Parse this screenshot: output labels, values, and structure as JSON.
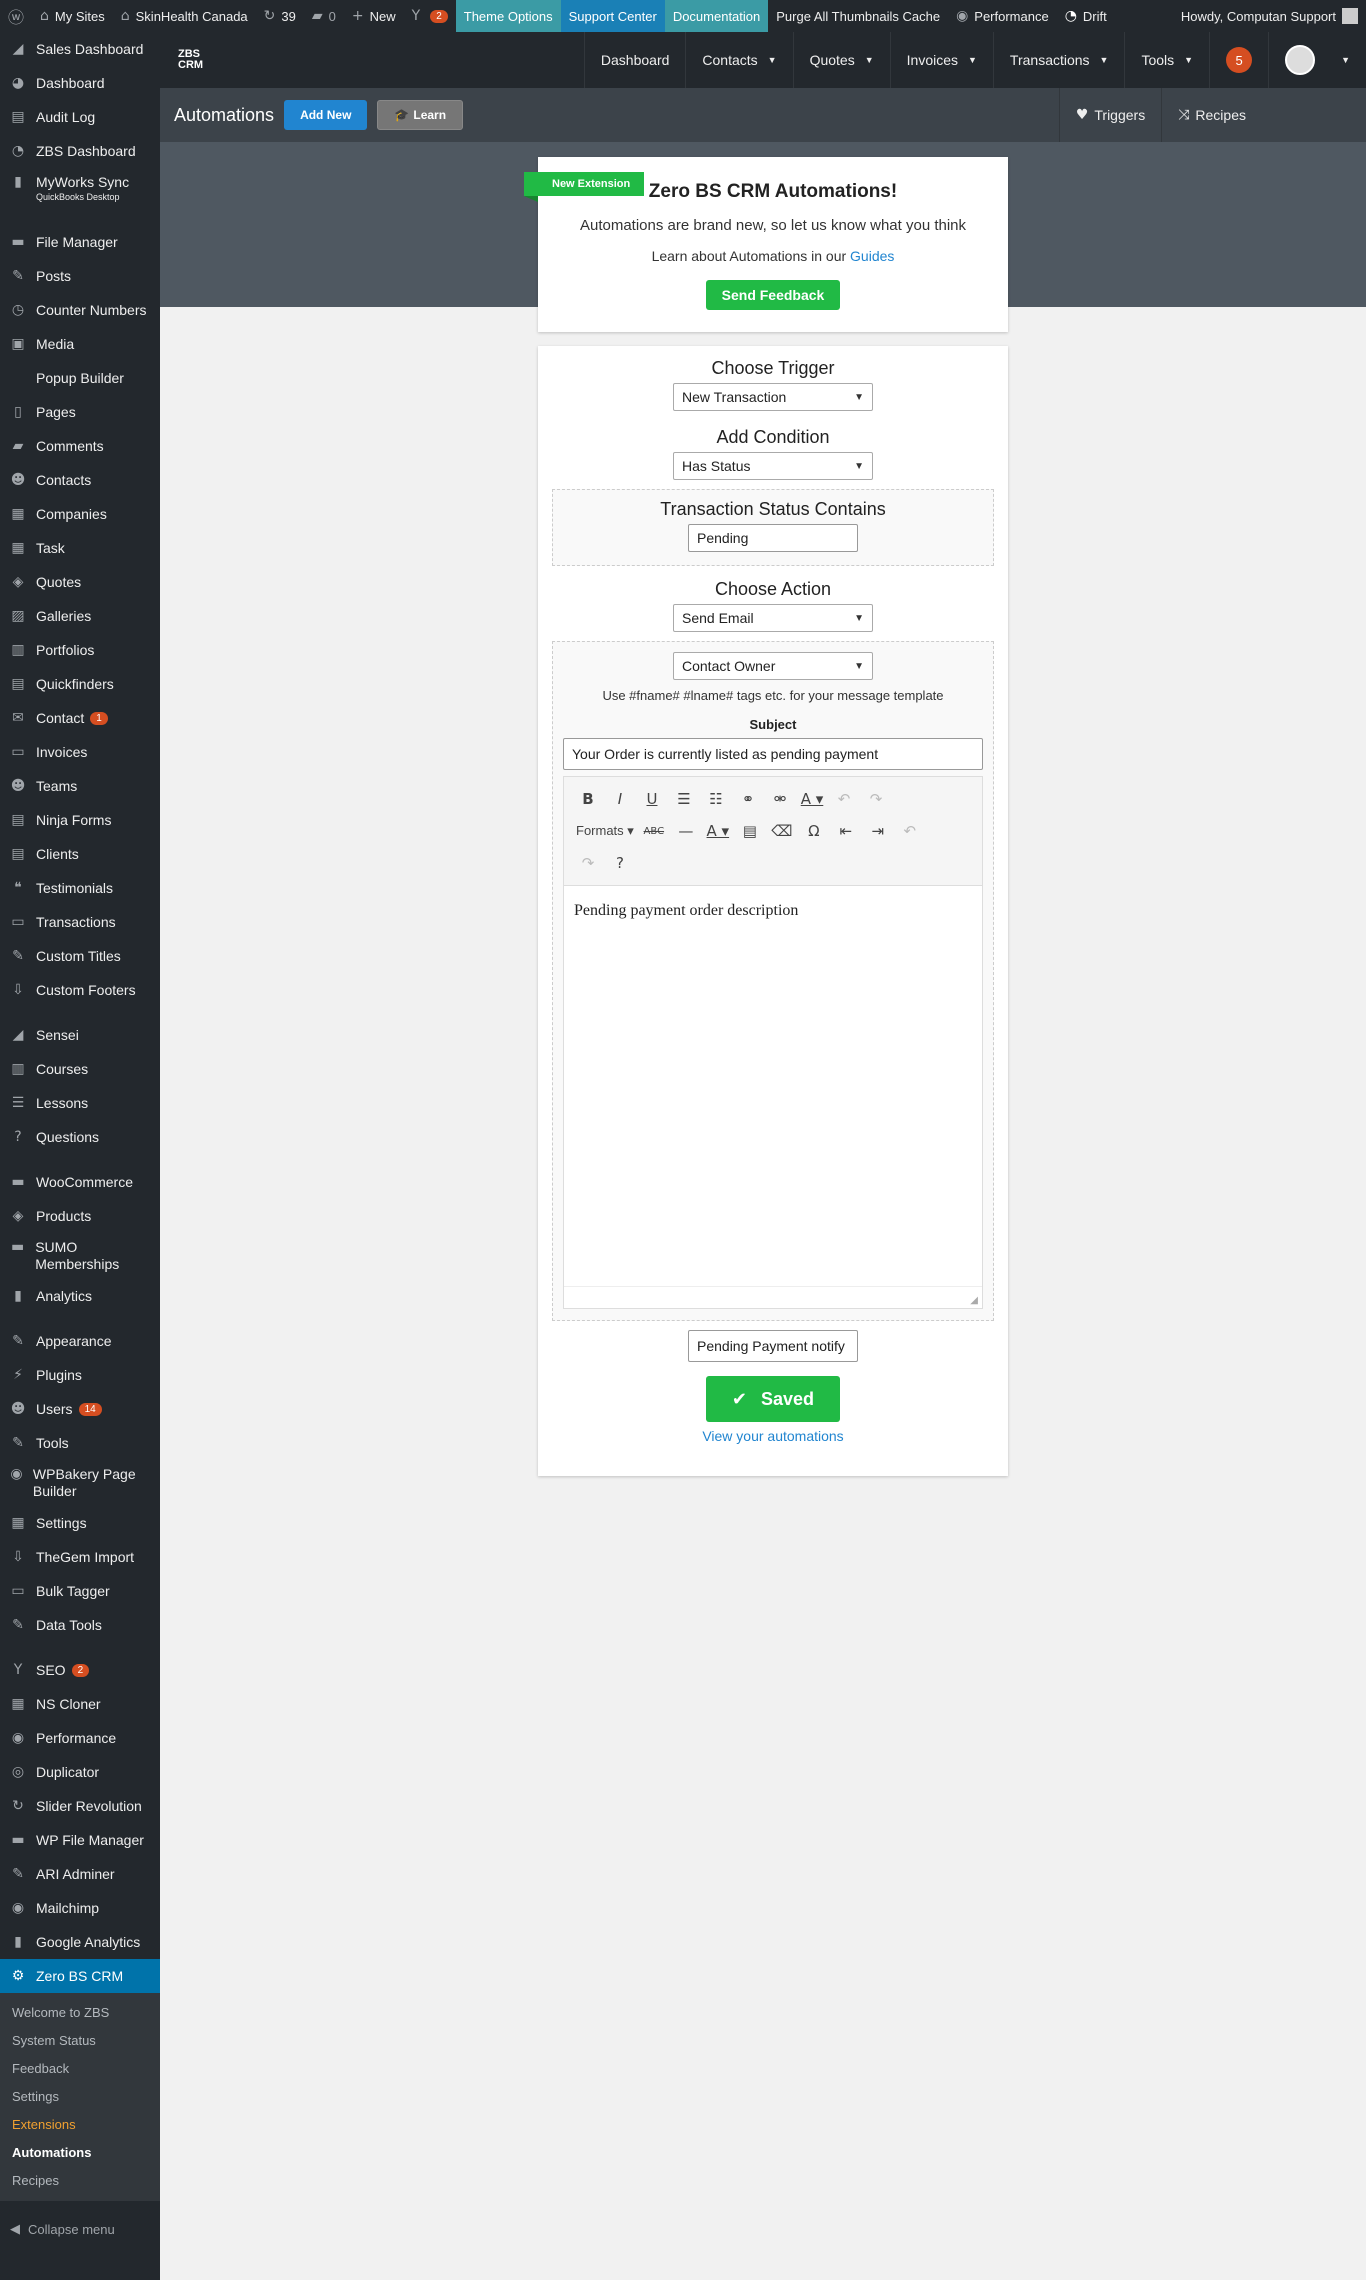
{
  "adminbar": {
    "my_sites": "My Sites",
    "site_name": "SkinHealth Canada",
    "updates_count": "39",
    "comments_count": "0",
    "new_label": "New",
    "yoast_count": "2",
    "theme_options": "Theme Options",
    "support_center": "Support Center",
    "documentation": "Documentation",
    "purge": "Purge All Thumbnails Cache",
    "performance": "Performance",
    "drift": "Drift",
    "howdy": "Howdy, Computan Support"
  },
  "sidebar": {
    "items": [
      {
        "label": "Sales Dashboard",
        "icon": "◢"
      },
      {
        "label": "Dashboard",
        "icon": "◕"
      },
      {
        "label": "Audit Log",
        "icon": "▤"
      },
      {
        "label": "ZBS Dashboard",
        "icon": "◔"
      },
      {
        "label": "MyWorks Sync",
        "sub": "QuickBooks Desktop",
        "icon": "▮"
      },
      {
        "label": "File Manager",
        "icon": "▬"
      },
      {
        "label": "Posts",
        "icon": "✎"
      },
      {
        "label": "Counter Numbers",
        "icon": "◷"
      },
      {
        "label": "Media",
        "icon": "▣"
      },
      {
        "label": "Popup Builder",
        "icon": ""
      },
      {
        "label": "Pages",
        "icon": "▯"
      },
      {
        "label": "Comments",
        "icon": "▰"
      },
      {
        "label": "Contacts",
        "icon": "☻"
      },
      {
        "label": "Companies",
        "icon": "▦"
      },
      {
        "label": "Task",
        "icon": "▦"
      },
      {
        "label": "Quotes",
        "icon": "◈"
      },
      {
        "label": "Galleries",
        "icon": "▨"
      },
      {
        "label": "Portfolios",
        "icon": "▥"
      },
      {
        "label": "Quickfinders",
        "icon": "▤"
      },
      {
        "label": "Contact",
        "badge": "1",
        "icon": "✉"
      },
      {
        "label": "Invoices",
        "icon": "▭"
      },
      {
        "label": "Teams",
        "icon": "☻"
      },
      {
        "label": "Ninja Forms",
        "icon": "▤"
      },
      {
        "label": "Clients",
        "icon": "▤"
      },
      {
        "label": "Testimonials",
        "icon": "❝"
      },
      {
        "label": "Transactions",
        "icon": "▭"
      },
      {
        "label": "Custom Titles",
        "icon": "✎"
      },
      {
        "label": "Custom Footers",
        "icon": "⇩"
      },
      {
        "label": "Sensei",
        "icon": "◢"
      },
      {
        "label": "Courses",
        "icon": "▥"
      },
      {
        "label": "Lessons",
        "icon": "☰"
      },
      {
        "label": "Questions",
        "icon": "?"
      },
      {
        "label": "WooCommerce",
        "icon": "▬"
      },
      {
        "label": "Products",
        "icon": "◈"
      },
      {
        "label": "SUMO Memberships",
        "icon": "▬"
      },
      {
        "label": "Analytics",
        "icon": "▮"
      },
      {
        "label": "Appearance",
        "icon": "✎"
      },
      {
        "label": "Plugins",
        "icon": "⚡"
      },
      {
        "label": "Users",
        "badge": "14",
        "icon": "☻"
      },
      {
        "label": "Tools",
        "icon": "✎"
      },
      {
        "label": "WPBakery Page Builder",
        "icon": "◉"
      },
      {
        "label": "Settings",
        "icon": "▦"
      },
      {
        "label": "TheGem Import",
        "icon": "⇩"
      },
      {
        "label": "Bulk Tagger",
        "icon": "▭"
      },
      {
        "label": "Data Tools",
        "icon": "✎"
      },
      {
        "label": "SEO",
        "badge": "2",
        "icon": "Y"
      },
      {
        "label": "NS Cloner",
        "icon": "▦"
      },
      {
        "label": "Performance",
        "icon": "◉"
      },
      {
        "label": "Duplicator",
        "icon": "◎"
      },
      {
        "label": "Slider Revolution",
        "icon": "↻"
      },
      {
        "label": "WP File Manager",
        "icon": "▬"
      },
      {
        "label": "ARI Adminer",
        "icon": "✎"
      },
      {
        "label": "Mailchimp",
        "icon": "◉"
      },
      {
        "label": "Google Analytics",
        "icon": "▮"
      },
      {
        "label": "Zero BS CRM",
        "icon": "⚙"
      }
    ],
    "submenu": [
      "Welcome to ZBS",
      "System Status",
      "Feedback",
      "Settings",
      "Extensions",
      "Automations",
      "Recipes"
    ],
    "collapse": "Collapse menu"
  },
  "zbs_nav": {
    "logo_line1": "ZBS",
    "logo_line2": "CRM",
    "items": [
      "Dashboard",
      "Contacts",
      "Quotes",
      "Invoices",
      "Transactions",
      "Tools"
    ],
    "notifications": "5"
  },
  "subheader": {
    "title": "Automations",
    "add_new": "Add New",
    "learn": "Learn",
    "triggers": "Triggers",
    "recipes": "Recipes"
  },
  "promo": {
    "ribbon": "New Extension",
    "title": "Zero BS CRM Automations!",
    "desc": "Automations are brand new, so let us know what you think",
    "learn_prefix": "Learn about Automations in our",
    "guides": "Guides",
    "feedback": "Send Feedback"
  },
  "builder": {
    "choose_trigger": "Choose Trigger",
    "trigger_value": "New Transaction",
    "add_condition": "Add Condition",
    "condition_value": "Has Status",
    "status_label": "Transaction Status Contains",
    "status_value": "Pending",
    "choose_action": "Choose Action",
    "action_value": "Send Email",
    "recipient_value": "Contact Owner",
    "tags_hint": "Use #fname# #lname# tags etc. for your message template",
    "subject_label": "Subject",
    "subject_value": "Your Order is currently listed as pending payment",
    "formats_label": "Formats",
    "body_text": "Pending payment order description",
    "name_value": "Pending Payment notify",
    "saved": "Saved",
    "view_link": "View your automations"
  }
}
